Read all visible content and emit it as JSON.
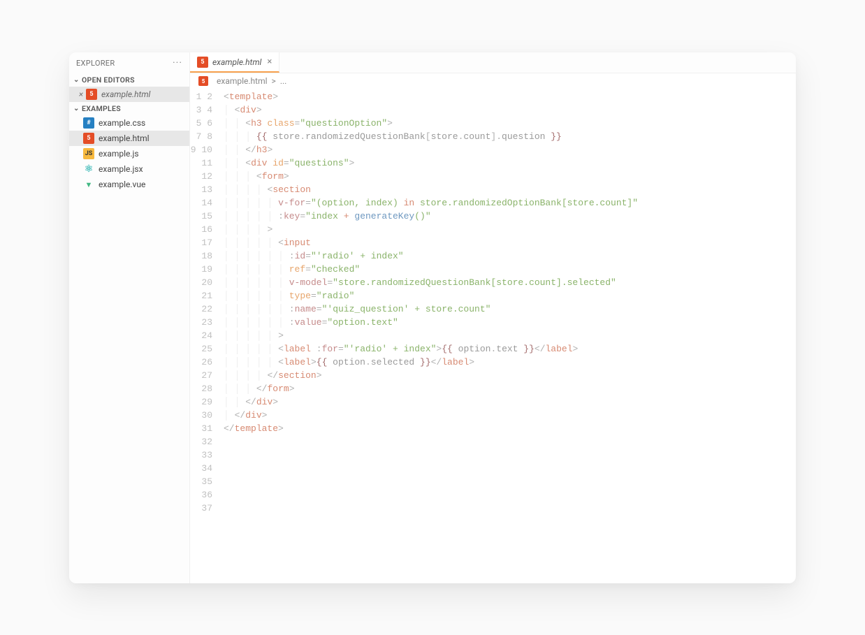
{
  "sidebar": {
    "title": "EXPLORER",
    "sections": {
      "open_editors": {
        "label": "OPEN EDITORS",
        "items": [
          {
            "name": "example.html",
            "icon": "html"
          }
        ]
      },
      "workspace": {
        "label": "EXAMPLES",
        "items": [
          {
            "name": "example.css",
            "icon": "css",
            "active": false
          },
          {
            "name": "example.html",
            "icon": "html",
            "active": true
          },
          {
            "name": "example.js",
            "icon": "js",
            "active": false
          },
          {
            "name": "example.jsx",
            "icon": "jsx",
            "active": false
          },
          {
            "name": "example.vue",
            "icon": "vue",
            "active": false
          }
        ]
      }
    }
  },
  "tabs": {
    "active": {
      "name": "example.html",
      "icon": "html"
    }
  },
  "breadcrumb": {
    "file": "example.html",
    "rest": "..."
  },
  "editor": {
    "total_lines": 37,
    "tokens": [
      [
        0,
        [
          [
            "pn",
            "<"
          ],
          [
            "tag",
            "template"
          ],
          [
            "pn",
            ">"
          ]
        ]
      ],
      [
        1,
        [
          [
            "pn",
            "<"
          ],
          [
            "tag",
            "div"
          ],
          [
            "pn",
            ">"
          ]
        ]
      ],
      [
        2,
        [
          [
            "pn",
            "<"
          ],
          [
            "tag",
            "h3"
          ],
          [
            "ident",
            " "
          ],
          [
            "attr",
            "class"
          ],
          [
            "pn",
            "="
          ],
          [
            "str",
            "\"questionOption\""
          ],
          [
            "pn",
            ">"
          ]
        ]
      ],
      [
        3,
        [
          [
            "mstch",
            "{{"
          ],
          [
            "ident",
            " store"
          ],
          [
            "pn",
            "."
          ],
          [
            "ident",
            "randomizedQuestionBank"
          ],
          [
            "pn",
            "["
          ],
          [
            "ident",
            "store"
          ],
          [
            "pn",
            "."
          ],
          [
            "ident",
            "count"
          ],
          [
            "pn",
            "]."
          ],
          [
            "ident",
            "question "
          ],
          [
            "mstch",
            "}}"
          ]
        ]
      ],
      [
        2,
        [
          [
            "pn",
            "</"
          ],
          [
            "tag",
            "h3"
          ],
          [
            "pn",
            ">"
          ]
        ]
      ],
      [
        2,
        [
          [
            "pn",
            "<"
          ],
          [
            "tag",
            "div"
          ],
          [
            "ident",
            " "
          ],
          [
            "attr",
            "id"
          ],
          [
            "pn",
            "="
          ],
          [
            "str",
            "\"questions\""
          ],
          [
            "pn",
            ">"
          ]
        ]
      ],
      [
        3,
        [
          [
            "pn",
            "<"
          ],
          [
            "tag",
            "form"
          ],
          [
            "pn",
            ">"
          ]
        ]
      ],
      [
        4,
        [
          [
            "pn",
            "<"
          ],
          [
            "tag",
            "section"
          ]
        ]
      ],
      [
        5,
        [
          [
            "dir",
            "v-for"
          ],
          [
            "pn",
            "="
          ],
          [
            "str",
            "\"(option, index) "
          ],
          [
            "op",
            "in"
          ],
          [
            "str",
            " store.randomizedOptionBank[store.count]\""
          ]
        ]
      ],
      [
        5,
        [
          [
            "pn",
            ":"
          ],
          [
            "dir",
            "key"
          ],
          [
            "pn",
            "="
          ],
          [
            "str",
            "\"index "
          ],
          [
            "op",
            "+"
          ],
          [
            "str",
            " "
          ],
          [
            "fn",
            "generateKey"
          ],
          [
            "str",
            "()\""
          ]
        ]
      ],
      [
        4,
        [
          [
            "pn",
            ">"
          ]
        ]
      ],
      [
        5,
        [
          [
            "pn",
            "<"
          ],
          [
            "tag",
            "input"
          ]
        ]
      ],
      [
        6,
        [
          [
            "pn",
            ":"
          ],
          [
            "dir",
            "id"
          ],
          [
            "pn",
            "="
          ],
          [
            "str",
            "\"'radio' + index\""
          ]
        ]
      ],
      [
        6,
        [
          [
            "attr",
            "ref"
          ],
          [
            "pn",
            "="
          ],
          [
            "str",
            "\"checked\""
          ]
        ]
      ],
      [
        6,
        [
          [
            "dir",
            "v-model"
          ],
          [
            "pn",
            "="
          ],
          [
            "str",
            "\"store.randomizedQuestionBank[store.count].selected\""
          ]
        ]
      ],
      [
        6,
        [
          [
            "attr",
            "type"
          ],
          [
            "pn",
            "="
          ],
          [
            "str",
            "\"radio\""
          ]
        ]
      ],
      [
        6,
        [
          [
            "pn",
            ":"
          ],
          [
            "dir",
            "name"
          ],
          [
            "pn",
            "="
          ],
          [
            "str",
            "\"'quiz_question' + store.count\""
          ]
        ]
      ],
      [
        6,
        [
          [
            "pn",
            ":"
          ],
          [
            "dir",
            "value"
          ],
          [
            "pn",
            "="
          ],
          [
            "str",
            "\"option.text\""
          ]
        ]
      ],
      [
        5,
        [
          [
            "pn",
            ">"
          ]
        ]
      ],
      [
        5,
        [
          [
            "pn",
            "<"
          ],
          [
            "tag",
            "label"
          ],
          [
            "ident",
            " "
          ],
          [
            "pn",
            ":"
          ],
          [
            "dir",
            "for"
          ],
          [
            "pn",
            "="
          ],
          [
            "str",
            "\"'radio' + index\""
          ],
          [
            "pn",
            ">"
          ],
          [
            "mstch",
            "{{"
          ],
          [
            "ident",
            " option"
          ],
          [
            "pn",
            "."
          ],
          [
            "ident",
            "text "
          ],
          [
            "mstch",
            "}}"
          ],
          [
            "pn",
            "</"
          ],
          [
            "tag",
            "label"
          ],
          [
            "pn",
            ">"
          ]
        ]
      ],
      [
        5,
        [
          [
            "pn",
            "<"
          ],
          [
            "tag",
            "label"
          ],
          [
            "pn",
            ">"
          ],
          [
            "mstch",
            "{{"
          ],
          [
            "ident",
            " option"
          ],
          [
            "pn",
            "."
          ],
          [
            "ident",
            "selected "
          ],
          [
            "mstch",
            "}}"
          ],
          [
            "pn",
            "</"
          ],
          [
            "tag",
            "label"
          ],
          [
            "pn",
            ">"
          ]
        ]
      ],
      [
        4,
        [
          [
            "pn",
            "</"
          ],
          [
            "tag",
            "section"
          ],
          [
            "pn",
            ">"
          ]
        ]
      ],
      [
        3,
        [
          [
            "pn",
            "</"
          ],
          [
            "tag",
            "form"
          ],
          [
            "pn",
            ">"
          ]
        ]
      ],
      [
        2,
        [
          [
            "pn",
            "</"
          ],
          [
            "tag",
            "div"
          ],
          [
            "pn",
            ">"
          ]
        ]
      ],
      [
        1,
        [
          [
            "pn",
            "</"
          ],
          [
            "tag",
            "div"
          ],
          [
            "pn",
            ">"
          ]
        ]
      ],
      [
        0,
        [
          [
            "pn",
            "</"
          ],
          [
            "tag",
            "template"
          ],
          [
            "pn",
            ">"
          ]
        ]
      ]
    ]
  },
  "icon_glyphs": {
    "html": "5",
    "css": "#",
    "js": "JS",
    "jsx": "⚛",
    "vue": "▼"
  }
}
